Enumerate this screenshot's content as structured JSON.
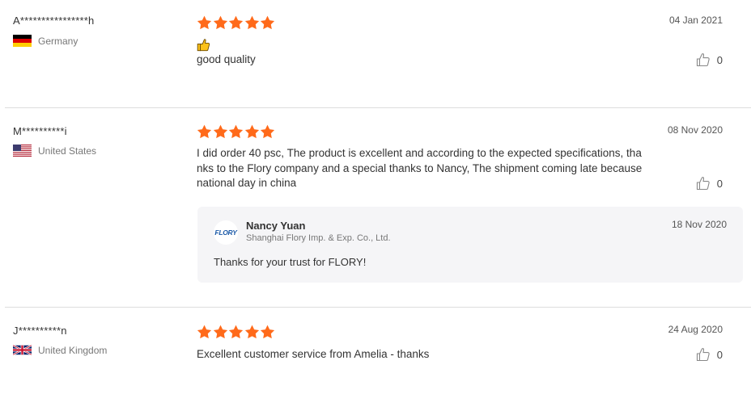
{
  "colors": {
    "star": "#ff6a1a",
    "separator": "#dddddd",
    "reply_bg": "#f5f5f7"
  },
  "icons": {
    "star": "star-icon",
    "helpful": "thumbs-up-icon",
    "emoji": "thumbs-up-emoji"
  },
  "reviews": [
    {
      "author": "A****************h",
      "country": "Germany",
      "flag": "germany-flag",
      "rating": 5,
      "date": "04 Jan 2021",
      "emoji": "👍",
      "text": "good quality",
      "helpful_count": "0"
    },
    {
      "author": "M**********i",
      "country": "United States",
      "flag": "us-flag",
      "rating": 5,
      "date": "08 Nov 2020",
      "text_lines": [
        "I did order 40 psc, The product is excellent and according to the expected specifications, tha",
        "nks to the Flory company and a special thanks to Nancy, The shipment coming late because",
        "national day in china"
      ],
      "helpful_count": "0",
      "reply": {
        "logo_text": "FLORY",
        "name": "Nancy Yuan",
        "company": "Shanghai Flory Imp. & Exp. Co., Ltd.",
        "date": "18 Nov 2020",
        "text": "Thanks for your trust for FLORY!"
      }
    },
    {
      "author": "J**********n",
      "country": "United Kingdom",
      "flag": "uk-flag",
      "rating": 5,
      "date": "24 Aug 2020",
      "text": "Excellent customer service from Amelia - thanks",
      "helpful_count": "0"
    }
  ]
}
